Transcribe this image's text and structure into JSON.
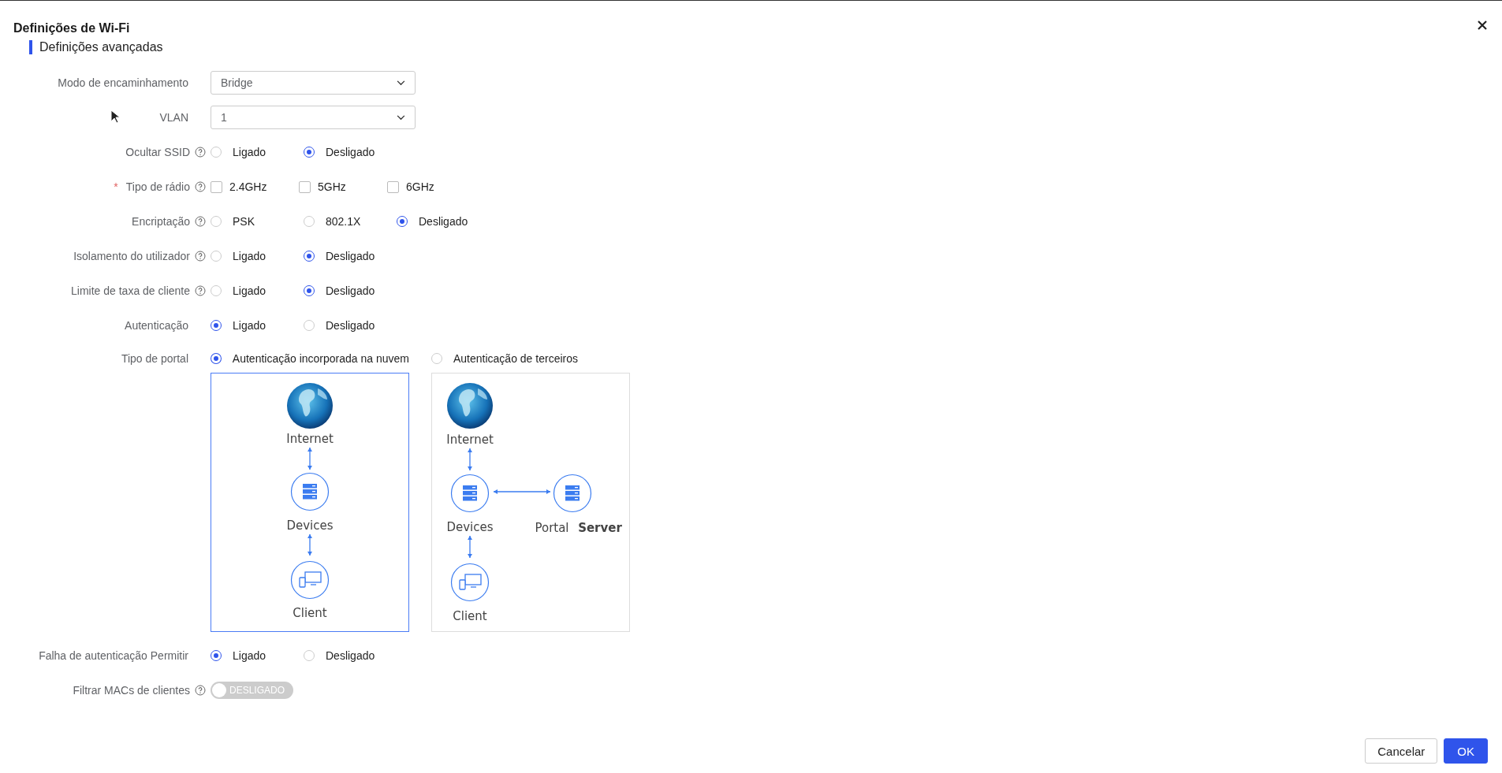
{
  "dialog": {
    "title": "Definições de Wi-Fi",
    "section": "Definições avançadas"
  },
  "fields": [
    {
      "kind": "select",
      "label": "Modo de encaminhamento",
      "value": "Bridge"
    },
    {
      "kind": "select",
      "label": "VLAN",
      "value": "1"
    },
    {
      "kind": "radio",
      "label": "Ocultar SSID",
      "help": true,
      "options": [
        {
          "label": "Ligado",
          "selected": false
        },
        {
          "label": "Desligado",
          "selected": true
        }
      ]
    },
    {
      "kind": "checkbox",
      "label": "Tipo de rádio",
      "required_mark": "*",
      "help": true,
      "options": [
        {
          "label": "2.4GHz",
          "checked": false
        },
        {
          "label": "5GHz",
          "checked": false
        },
        {
          "label": "6GHz",
          "checked": false
        }
      ]
    },
    {
      "kind": "radio",
      "label": "Encriptação",
      "help": true,
      "options": [
        {
          "label": "PSK",
          "selected": false
        },
        {
          "label": "802.1X",
          "selected": false
        },
        {
          "label": "Desligado",
          "selected": true
        }
      ]
    },
    {
      "kind": "radio",
      "label": "Isolamento do utilizador",
      "help": true,
      "options": [
        {
          "label": "Ligado",
          "selected": false
        },
        {
          "label": "Desligado",
          "selected": true
        }
      ]
    },
    {
      "kind": "radio",
      "label": "Limite de taxa de cliente",
      "help": true,
      "options": [
        {
          "label": "Ligado",
          "selected": false
        },
        {
          "label": "Desligado",
          "selected": true
        }
      ]
    },
    {
      "kind": "radio",
      "label": "Autenticação",
      "options": [
        {
          "label": "Ligado",
          "selected": true
        },
        {
          "label": "Desligado",
          "selected": false
        }
      ]
    },
    {
      "kind": "portal",
      "label": "Tipo de portal",
      "options": [
        {
          "label": "Autenticação incorporada na nuvem",
          "selected": true,
          "kind": "chain",
          "nodes": [
            "Internet",
            "Devices",
            "Client"
          ]
        },
        {
          "label": "Autenticação de terceiros",
          "selected": false,
          "kind": "branch",
          "nodes": [
            "Internet",
            "Devices",
            "Portal",
            "Server",
            "Client"
          ]
        }
      ]
    },
    {
      "kind": "radio",
      "label": "Falha de autenticação Permitir",
      "options": [
        {
          "label": "Ligado",
          "selected": true
        },
        {
          "label": "Desligado",
          "selected": false
        }
      ]
    },
    {
      "kind": "toggle",
      "label": "Filtrar MACs de clientes",
      "help": true,
      "on": false,
      "text": "DESLIGADO"
    }
  ],
  "buttons": [
    {
      "label": "Cancelar",
      "kind": "secondary"
    },
    {
      "label": "OK",
      "kind": "primary"
    }
  ]
}
